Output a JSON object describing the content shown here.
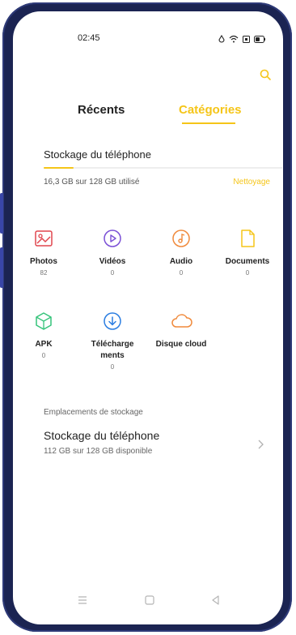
{
  "status_bar": {
    "time": "02:45",
    "icons": [
      "drop-icon",
      "wifi-icon",
      "notification-icon",
      "battery-icon"
    ]
  },
  "top_bar": {
    "search_icon": "search-icon"
  },
  "tabs": [
    {
      "label": "Récents",
      "active": false
    },
    {
      "label": "Catégories",
      "active": true
    }
  ],
  "storage": {
    "title": "Stockage du téléphone",
    "used_text": "16,3 GB sur 128 GB utilisé",
    "used_fraction": 0.127,
    "clean_label": "Nettoyage"
  },
  "categories": [
    {
      "label": "Photos",
      "count": "82",
      "icon": "photos-icon",
      "color": "#e0464e"
    },
    {
      "label": "Vidéos",
      "count": "0",
      "icon": "video-icon",
      "color": "#7a4fd6"
    },
    {
      "label": "Audio",
      "count": "0",
      "icon": "audio-icon",
      "color": "#f08a3c"
    },
    {
      "label": "Documents",
      "count": "0",
      "icon": "document-icon",
      "color": "#f5c518"
    },
    {
      "label": "APK",
      "count": "0",
      "icon": "apk-icon",
      "color": "#35c47a"
    },
    {
      "label": "Téléchargements",
      "count": "0",
      "icon": "download-icon",
      "color": "#2a7de1"
    },
    {
      "label": "Disque cloud",
      "count": "",
      "icon": "cloud-icon",
      "color": "#f08a3c"
    }
  ],
  "locations": {
    "heading": "Emplacements de stockage",
    "items": [
      {
        "title": "Stockage du téléphone",
        "subtitle": "112 GB sur 128 GB disponible"
      }
    ]
  },
  "colors": {
    "accent": "#f5c518"
  }
}
